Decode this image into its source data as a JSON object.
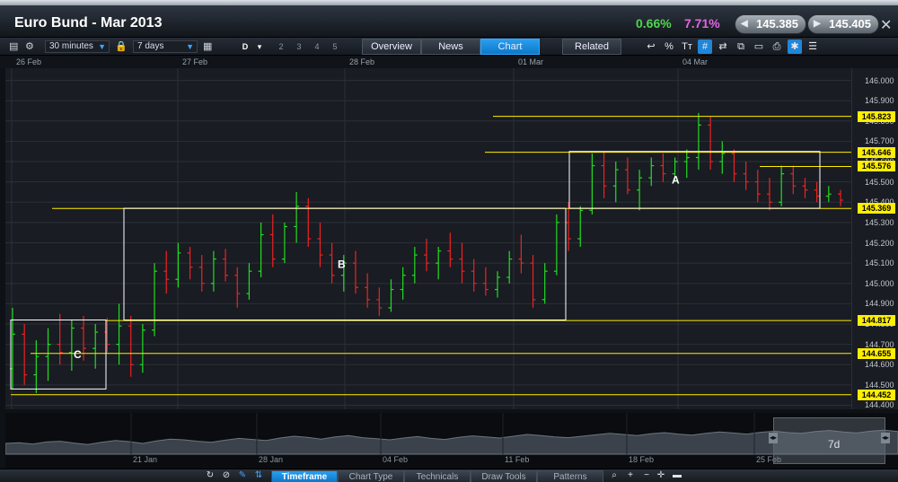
{
  "window": {
    "title": "Euro Bund - Mar 2013",
    "change_pct": "0.66%",
    "volatility_pct": "7.71%",
    "sell_price": "145.385",
    "buy_price": "145.405",
    "close_glyph": "✕"
  },
  "toolbar": {
    "interval": "30 minutes",
    "period": "7 days",
    "chart_style": "D",
    "layout_numbers": [
      "2",
      "3",
      "4",
      "5"
    ],
    "tabs": [
      {
        "label": "Overview",
        "active": false
      },
      {
        "label": "News",
        "active": false
      },
      {
        "label": "Chart",
        "active": true
      },
      {
        "label": "Related",
        "active": false
      }
    ],
    "icons": [
      "undo-icon",
      "percent-icon",
      "text-size-icon",
      "grid-icon",
      "indicators-icon",
      "compare-icon",
      "layout-icon",
      "print-icon",
      "settings-icon",
      "menu-icon"
    ],
    "icon_glyphs": [
      "↩",
      "%",
      "Tт",
      "#",
      "⇄",
      "⧉",
      "▭",
      "⎙",
      "✱",
      "☰"
    ]
  },
  "date_labels": [
    "26 Feb",
    "27 Feb",
    "28 Feb",
    "01 Mar",
    "04 Mar"
  ],
  "chart_data": {
    "type": "candlestick",
    "instrument": "Euro Bund - Mar 2013",
    "interval": "30 minutes",
    "y_ticks": [
      "146.000",
      "145.900",
      "145.800",
      "145.700",
      "145.600",
      "145.500",
      "145.400",
      "145.300",
      "145.200",
      "145.100",
      "145.000",
      "144.900",
      "144.800",
      "144.700",
      "144.600",
      "144.500",
      "144.400"
    ],
    "ylim": [
      144.38,
      146.06
    ],
    "x_categories": [
      "26 Feb",
      "27 Feb",
      "28 Feb",
      "01 Mar",
      "04 Mar"
    ],
    "price_levels": [
      145.823,
      145.646,
      145.576,
      145.369,
      144.817,
      144.655,
      144.452
    ],
    "level_labels": [
      "145.823",
      "145.646",
      "145.576",
      "145.369",
      "144.817",
      "144.655",
      "144.452"
    ],
    "zones": [
      {
        "label": "C",
        "low": 144.48,
        "high": 144.82
      },
      {
        "label": "B",
        "low": 144.82,
        "high": 145.37
      },
      {
        "label": "A",
        "low": 145.37,
        "high": 145.65
      }
    ],
    "up_color": "#22dd22",
    "down_color": "#ee2222",
    "level_color": "#ffee00",
    "zone_color": "#ffffff",
    "series": [
      {
        "o": 144.58,
        "h": 144.88,
        "l": 144.48,
        "c": 144.75
      },
      {
        "o": 144.75,
        "h": 144.8,
        "l": 144.5,
        "c": 144.55
      },
      {
        "o": 144.55,
        "h": 144.72,
        "l": 144.46,
        "c": 144.64
      },
      {
        "o": 144.64,
        "h": 144.78,
        "l": 144.52,
        "c": 144.7
      },
      {
        "o": 144.7,
        "h": 144.85,
        "l": 144.6,
        "c": 144.66
      },
      {
        "o": 144.66,
        "h": 144.82,
        "l": 144.57,
        "c": 144.78
      },
      {
        "o": 144.78,
        "h": 144.84,
        "l": 144.62,
        "c": 144.68
      },
      {
        "o": 144.68,
        "h": 144.8,
        "l": 144.58,
        "c": 144.76
      },
      {
        "o": 144.76,
        "h": 144.83,
        "l": 144.66,
        "c": 144.7
      },
      {
        "o": 144.7,
        "h": 144.9,
        "l": 144.6,
        "c": 144.79
      },
      {
        "o": 144.79,
        "h": 144.84,
        "l": 144.54,
        "c": 144.6
      },
      {
        "o": 144.6,
        "h": 144.8,
        "l": 144.56,
        "c": 144.77
      },
      {
        "o": 144.77,
        "h": 145.1,
        "l": 144.74,
        "c": 145.06
      },
      {
        "o": 145.06,
        "h": 145.16,
        "l": 144.95,
        "c": 145.02
      },
      {
        "o": 145.02,
        "h": 145.2,
        "l": 144.98,
        "c": 145.15
      },
      {
        "o": 145.15,
        "h": 145.18,
        "l": 145.02,
        "c": 145.08
      },
      {
        "o": 145.08,
        "h": 145.14,
        "l": 144.96,
        "c": 145.0
      },
      {
        "o": 145.0,
        "h": 145.16,
        "l": 144.96,
        "c": 145.12
      },
      {
        "o": 145.12,
        "h": 145.17,
        "l": 145.01,
        "c": 145.04
      },
      {
        "o": 145.04,
        "h": 145.08,
        "l": 144.88,
        "c": 144.95
      },
      {
        "o": 144.95,
        "h": 145.1,
        "l": 144.92,
        "c": 145.06
      },
      {
        "o": 145.06,
        "h": 145.3,
        "l": 145.03,
        "c": 145.24
      },
      {
        "o": 145.24,
        "h": 145.34,
        "l": 145.08,
        "c": 145.12
      },
      {
        "o": 145.12,
        "h": 145.3,
        "l": 145.1,
        "c": 145.28
      },
      {
        "o": 145.28,
        "h": 145.45,
        "l": 145.2,
        "c": 145.38
      },
      {
        "o": 145.38,
        "h": 145.42,
        "l": 145.18,
        "c": 145.22
      },
      {
        "o": 145.22,
        "h": 145.3,
        "l": 145.08,
        "c": 145.14
      },
      {
        "o": 145.14,
        "h": 145.2,
        "l": 145.0,
        "c": 145.04
      },
      {
        "o": 145.04,
        "h": 145.14,
        "l": 144.96,
        "c": 145.1
      },
      {
        "o": 145.1,
        "h": 145.16,
        "l": 144.95,
        "c": 144.98
      },
      {
        "o": 144.98,
        "h": 145.05,
        "l": 144.88,
        "c": 144.92
      },
      {
        "o": 144.92,
        "h": 144.98,
        "l": 144.84,
        "c": 144.88
      },
      {
        "o": 144.88,
        "h": 145.02,
        "l": 144.86,
        "c": 144.97
      },
      {
        "o": 144.97,
        "h": 145.08,
        "l": 144.92,
        "c": 145.04
      },
      {
        "o": 145.04,
        "h": 145.18,
        "l": 145.0,
        "c": 145.14
      },
      {
        "o": 145.14,
        "h": 145.22,
        "l": 145.06,
        "c": 145.1
      },
      {
        "o": 145.1,
        "h": 145.18,
        "l": 145.02,
        "c": 145.16
      },
      {
        "o": 145.16,
        "h": 145.25,
        "l": 145.08,
        "c": 145.12
      },
      {
        "o": 145.12,
        "h": 145.2,
        "l": 145.0,
        "c": 145.06
      },
      {
        "o": 145.06,
        "h": 145.12,
        "l": 144.96,
        "c": 145.0
      },
      {
        "o": 145.0,
        "h": 145.08,
        "l": 144.94,
        "c": 144.97
      },
      {
        "o": 144.97,
        "h": 145.06,
        "l": 144.93,
        "c": 145.03
      },
      {
        "o": 145.03,
        "h": 145.16,
        "l": 145.0,
        "c": 145.12
      },
      {
        "o": 145.12,
        "h": 145.24,
        "l": 145.05,
        "c": 145.1
      },
      {
        "o": 145.1,
        "h": 145.14,
        "l": 144.88,
        "c": 144.92
      },
      {
        "o": 144.92,
        "h": 145.1,
        "l": 144.9,
        "c": 145.06
      },
      {
        "o": 145.06,
        "h": 145.34,
        "l": 145.04,
        "c": 145.3
      },
      {
        "o": 145.3,
        "h": 145.4,
        "l": 145.16,
        "c": 145.22
      },
      {
        "o": 145.22,
        "h": 145.38,
        "l": 145.18,
        "c": 145.36
      },
      {
        "o": 145.36,
        "h": 145.64,
        "l": 145.34,
        "c": 145.58
      },
      {
        "o": 145.58,
        "h": 145.65,
        "l": 145.42,
        "c": 145.48
      },
      {
        "o": 145.48,
        "h": 145.6,
        "l": 145.4,
        "c": 145.56
      },
      {
        "o": 145.56,
        "h": 145.62,
        "l": 145.44,
        "c": 145.46
      },
      {
        "o": 145.46,
        "h": 145.56,
        "l": 145.36,
        "c": 145.52
      },
      {
        "o": 145.52,
        "h": 145.62,
        "l": 145.48,
        "c": 145.58
      },
      {
        "o": 145.58,
        "h": 145.64,
        "l": 145.5,
        "c": 145.54
      },
      {
        "o": 145.54,
        "h": 145.62,
        "l": 145.5,
        "c": 145.6
      },
      {
        "o": 145.6,
        "h": 145.66,
        "l": 145.52,
        "c": 145.62
      },
      {
        "o": 145.62,
        "h": 145.84,
        "l": 145.56,
        "c": 145.78
      },
      {
        "o": 145.78,
        "h": 145.82,
        "l": 145.56,
        "c": 145.6
      },
      {
        "o": 145.6,
        "h": 145.7,
        "l": 145.54,
        "c": 145.64
      },
      {
        "o": 145.64,
        "h": 145.66,
        "l": 145.5,
        "c": 145.54
      },
      {
        "o": 145.54,
        "h": 145.6,
        "l": 145.46,
        "c": 145.5
      },
      {
        "o": 145.5,
        "h": 145.56,
        "l": 145.4,
        "c": 145.44
      },
      {
        "o": 145.44,
        "h": 145.52,
        "l": 145.36,
        "c": 145.4
      },
      {
        "o": 145.4,
        "h": 145.58,
        "l": 145.38,
        "c": 145.54
      },
      {
        "o": 145.54,
        "h": 145.58,
        "l": 145.44,
        "c": 145.48
      },
      {
        "o": 145.48,
        "h": 145.52,
        "l": 145.42,
        "c": 145.46
      },
      {
        "o": 145.46,
        "h": 145.5,
        "l": 145.4,
        "c": 145.43
      },
      {
        "o": 145.43,
        "h": 145.48,
        "l": 145.4,
        "c": 145.44
      },
      {
        "o": 145.44,
        "h": 145.46,
        "l": 145.38,
        "c": 145.41
      }
    ]
  },
  "overview": {
    "labels": [
      "21 Jan",
      "28 Jan",
      "04 Feb",
      "11 Feb",
      "18 Feb",
      "25 Feb"
    ],
    "window_label": "7d",
    "volume_profile": [
      0.3,
      0.32,
      0.28,
      0.34,
      0.36,
      0.31,
      0.27,
      0.33,
      0.38,
      0.35,
      0.3,
      0.37,
      0.42,
      0.4,
      0.36,
      0.33,
      0.39,
      0.44,
      0.41,
      0.38,
      0.45,
      0.5,
      0.47,
      0.42,
      0.48,
      0.52,
      0.46,
      0.43,
      0.4,
      0.45,
      0.49,
      0.44,
      0.41,
      0.47,
      0.51,
      0.48,
      0.45,
      0.5,
      0.55,
      0.52,
      0.48,
      0.46,
      0.5,
      0.54,
      0.58,
      0.55,
      0.52,
      0.57,
      0.6,
      0.56,
      0.53,
      0.58,
      0.62,
      0.59,
      0.56,
      0.61,
      0.64,
      0.6,
      0.58,
      0.63,
      0.66,
      0.62,
      0.59,
      0.64,
      0.67,
      0.63
    ]
  },
  "bottom": {
    "tabs": [
      {
        "label": "Timeframe",
        "active": true
      },
      {
        "label": "Chart Type",
        "active": false
      },
      {
        "label": "Technicals",
        "active": false
      },
      {
        "label": "Draw Tools",
        "active": false
      },
      {
        "label": "Patterns",
        "active": false
      }
    ]
  }
}
